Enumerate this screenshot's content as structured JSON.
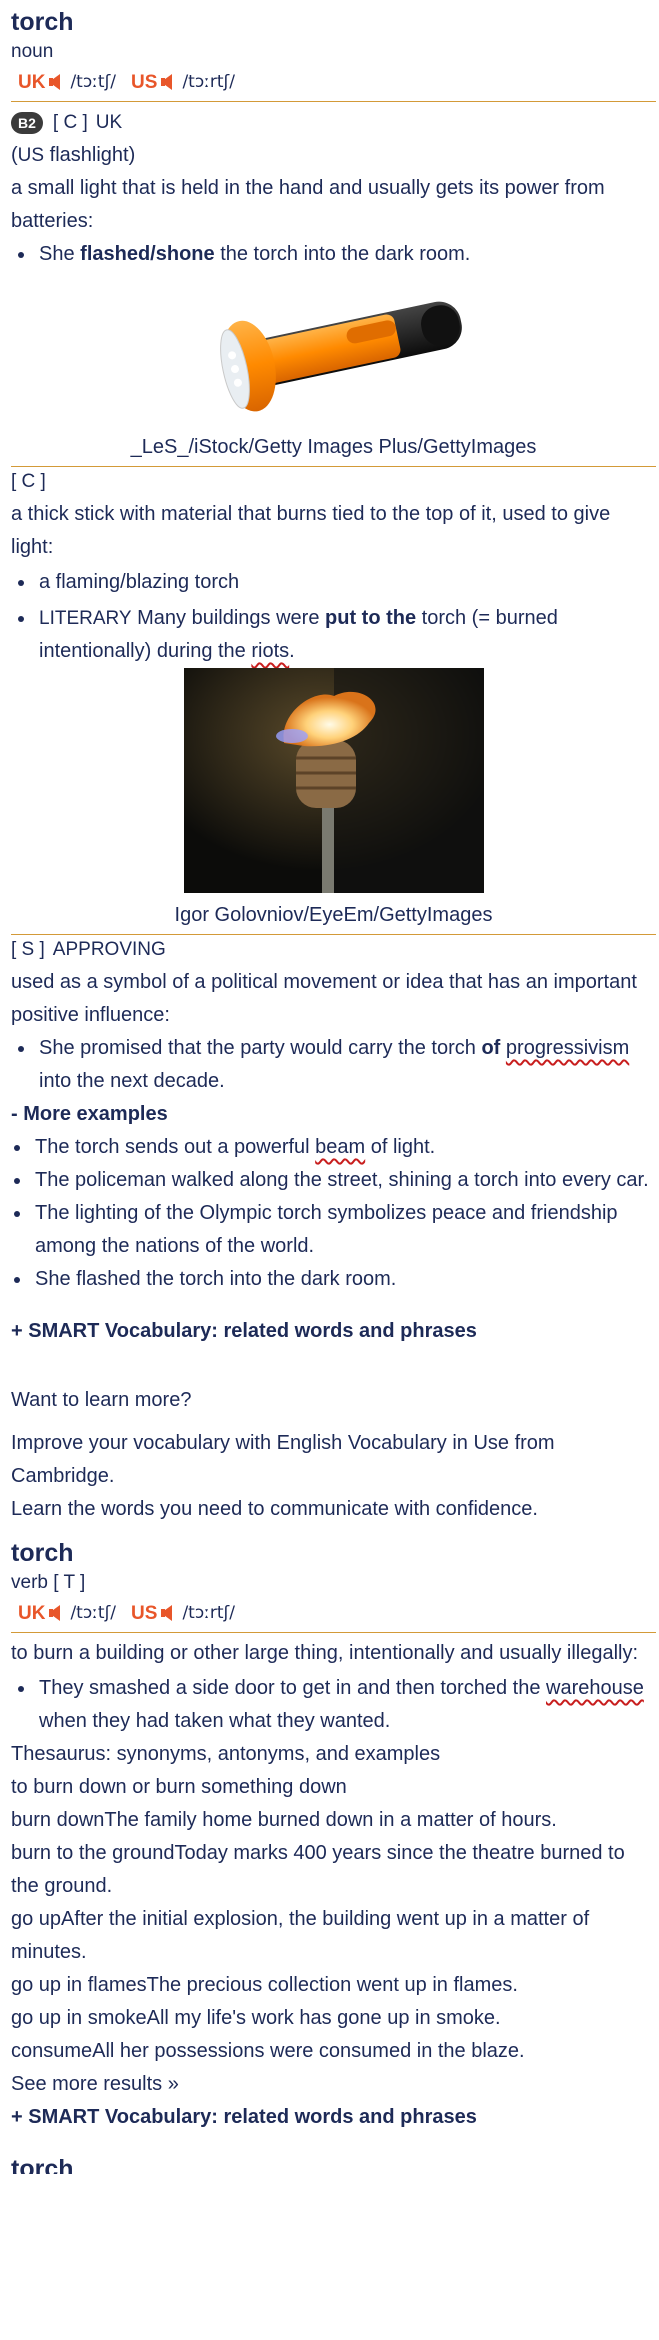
{
  "entry1": {
    "headword": "torch",
    "pos": "noun",
    "uk_label": "UK",
    "uk_ipa": "/tɔːtʃ/",
    "us_label": "US",
    "us_ipa": "/tɔːrtʃ/"
  },
  "sense1": {
    "level": "B2",
    "grammar": "[ C ]",
    "region": "UK",
    "variant_region": "US",
    "variant_word": "flashlight",
    "definition": "a small light that is held in the hand and usually gets its power from batteries:",
    "example_pre": "She ",
    "example_bold": "flashed/shone",
    "example_post": " the torch into the dark room.",
    "credit": "_LeS_/iStock/Getty Images Plus/GettyImages"
  },
  "sense2": {
    "grammar": "[ C ]",
    "definition": "a thick stick with material that burns tied to the top of it, used to give light:",
    "example1": "a flaming/blazing torch",
    "example2_label": "LITERARY",
    "example2_pre": " Many buildings were ",
    "example2_bold": "put to the",
    "example2_mid": " torch (= burned intentionally) during the ",
    "example2_link": "riots",
    "example2_post": ".",
    "credit": "Igor Golovniov/EyeEm/GettyImages"
  },
  "sense3": {
    "grammar": "[ S ]",
    "label": "APPROVING",
    "definition": "used as a symbol of a political movement or idea that has an important positive influence:",
    "example_pre": "She promised that the party would carry the torch ",
    "example_bold": "of",
    "example_link": "progressivism",
    "example_post": " into the next decade."
  },
  "more_examples": {
    "heading": "- More examples",
    "ex1_pre": "The torch sends out a powerful ",
    "ex1_link": "beam",
    "ex1_post": " of light.",
    "ex2": "The policeman walked along the street, shining a torch into every car.",
    "ex3": "The lighting of the Olympic torch symbolizes peace and friendship among the nations of the world.",
    "ex4": "She flashed the torch into the dark room."
  },
  "smart1": "+ SMART Vocabulary: related words and phrases",
  "promo": {
    "question": "Want to learn more?",
    "line1": "Improve your vocabulary with English Vocabulary in Use from Cambridge.",
    "line2": "Learn the words you need to communicate with confidence."
  },
  "entry2": {
    "headword": "torch",
    "pos": "verb [ T ]",
    "uk_label": "UK",
    "uk_ipa": "/tɔːtʃ/",
    "us_label": "US",
    "us_ipa": "/tɔːrtʃ/",
    "definition": "to burn a building or other large thing, intentionally and usually illegally:",
    "example_pre": "They smashed a side door to get in and then torched the ",
    "example_link": "warehouse",
    "example_post": " when they had taken what they wanted."
  },
  "thesaurus": {
    "heading": "Thesaurus: synonyms, antonyms, and examples",
    "subheading": "to burn down or burn something down",
    "lines": [
      "burn downThe family home burned down in a matter of hours.",
      "burn to the groundToday marks 400 years since the theatre burned to the ground.",
      "go upAfter the initial explosion, the building went up in a matter of minutes.",
      "go up in flamesThe precious collection went up in flames.",
      "go up in smokeAll my life's work has gone up in smoke.",
      "consumeAll her possessions were consumed in the blaze."
    ],
    "see_more": "See more results »"
  },
  "smart2": "+ SMART Vocabulary: related words and phrases",
  "entry3_headword": "torch",
  "colors": {
    "accent": "#e8562a",
    "rule": "#d39a38",
    "text": "#1d2a57",
    "underline": "#c81e1e"
  },
  "icons": {
    "speaker": "speaker-icon"
  }
}
